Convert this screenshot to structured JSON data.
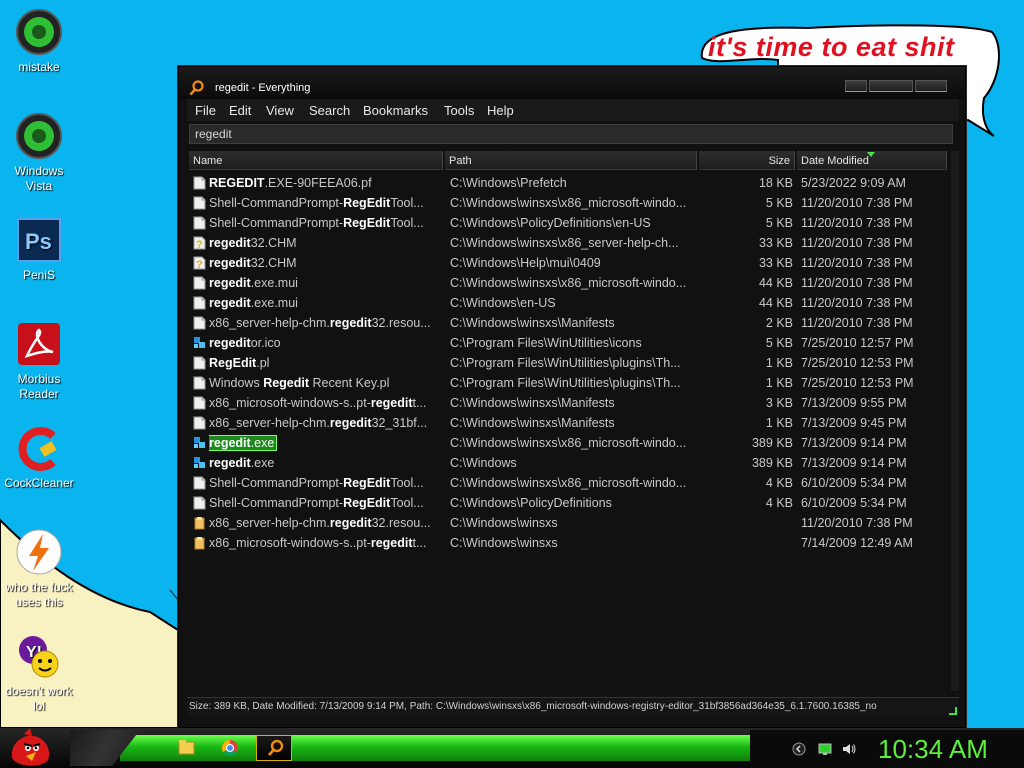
{
  "speech_bubble": {
    "text": "it's time to eat shit"
  },
  "desktop_icons": [
    {
      "label": "mistake"
    },
    {
      "label": "Windows Vista"
    },
    {
      "label": "PeniS"
    },
    {
      "label": "Morbius Reader"
    },
    {
      "label": "CockCleaner"
    },
    {
      "label": "who the fuck uses this"
    },
    {
      "label": "doesn't work lol"
    }
  ],
  "window": {
    "title": "regedit - Everything",
    "menu": [
      "File",
      "Edit",
      "View",
      "Search",
      "Bookmarks",
      "Tools",
      "Help"
    ],
    "search_value": "regedit",
    "columns": {
      "name": "Name",
      "path": "Path",
      "size": "Size",
      "date": "Date Modified"
    },
    "rows": [
      {
        "pre": "",
        "hl": "REGEDIT",
        "post": ".EXE-90FEEA06.pf",
        "path": "C:\\Windows\\Prefetch",
        "size": "18 KB",
        "date": "5/23/2022 9:09 AM",
        "icon": "doc-icon"
      },
      {
        "pre": "Shell-CommandPrompt-",
        "hl": "RegEdit",
        "post": "Tool...",
        "path": "C:\\Windows\\winsxs\\x86_microsoft-windo...",
        "size": "5 KB",
        "date": "11/20/2010 7:38 PM",
        "icon": "doc-icon"
      },
      {
        "pre": "Shell-CommandPrompt-",
        "hl": "RegEdit",
        "post": "Tool...",
        "path": "C:\\Windows\\PolicyDefinitions\\en-US",
        "size": "5 KB",
        "date": "11/20/2010 7:38 PM",
        "icon": "doc-icon"
      },
      {
        "pre": "",
        "hl": "regedit",
        "post": "32.CHM",
        "path": "C:\\Windows\\winsxs\\x86_server-help-ch...",
        "size": "33 KB",
        "date": "11/20/2010 7:38 PM",
        "icon": "help-file-icon"
      },
      {
        "pre": "",
        "hl": "regedit",
        "post": "32.CHM",
        "path": "C:\\Windows\\Help\\mui\\0409",
        "size": "33 KB",
        "date": "11/20/2010 7:38 PM",
        "icon": "help-file-icon"
      },
      {
        "pre": "",
        "hl": "regedit",
        "post": ".exe.mui",
        "path": "C:\\Windows\\winsxs\\x86_microsoft-windo...",
        "size": "44 KB",
        "date": "11/20/2010 7:38 PM",
        "icon": "doc-icon"
      },
      {
        "pre": "",
        "hl": "regedit",
        "post": ".exe.mui",
        "path": "C:\\Windows\\en-US",
        "size": "44 KB",
        "date": "11/20/2010 7:38 PM",
        "icon": "doc-icon"
      },
      {
        "pre": "x86_server-help-chm.",
        "hl": "regedit",
        "post": "32.resou...",
        "path": "C:\\Windows\\winsxs\\Manifests",
        "size": "2 KB",
        "date": "11/20/2010 7:38 PM",
        "icon": "doc-icon"
      },
      {
        "pre": "",
        "hl": "regedit",
        "post": "or.ico",
        "path": "C:\\Program Files\\WinUtilities\\icons",
        "size": "5 KB",
        "date": "7/25/2010 12:57 PM",
        "icon": "registry-icon"
      },
      {
        "pre": "",
        "hl": "RegEdit",
        "post": ".pl",
        "path": "C:\\Program Files\\WinUtilities\\plugins\\Th...",
        "size": "1 KB",
        "date": "7/25/2010 12:53 PM",
        "icon": "doc-icon"
      },
      {
        "pre": "Windows ",
        "hl": "Regedit",
        "post": " Recent Key.pl",
        "path": "C:\\Program Files\\WinUtilities\\plugins\\Th...",
        "size": "1 KB",
        "date": "7/25/2010 12:53 PM",
        "icon": "doc-icon"
      },
      {
        "pre": "x86_microsoft-windows-s..pt-",
        "hl": "regedit",
        "post": "t...",
        "path": "C:\\Windows\\winsxs\\Manifests",
        "size": "3 KB",
        "date": "7/13/2009 9:55 PM",
        "icon": "doc-icon"
      },
      {
        "pre": "x86_server-help-chm.",
        "hl": "regedit",
        "post": "32_31bf...",
        "path": "C:\\Windows\\winsxs\\Manifests",
        "size": "1 KB",
        "date": "7/13/2009 9:45 PM",
        "icon": "doc-icon"
      },
      {
        "pre": "",
        "hl": "regedit",
        "post": ".exe",
        "path": "C:\\Windows\\winsxs\\x86_microsoft-windo...",
        "size": "389 KB",
        "date": "7/13/2009 9:14 PM",
        "icon": "registry-icon",
        "selected": true
      },
      {
        "pre": "",
        "hl": "regedit",
        "post": ".exe",
        "path": "C:\\Windows",
        "size": "389 KB",
        "date": "7/13/2009 9:14 PM",
        "icon": "registry-icon"
      },
      {
        "pre": "Shell-CommandPrompt-",
        "hl": "RegEdit",
        "post": "Tool...",
        "path": "C:\\Windows\\winsxs\\x86_microsoft-windo...",
        "size": "4 KB",
        "date": "6/10/2009 5:34 PM",
        "icon": "doc-icon"
      },
      {
        "pre": "Shell-CommandPrompt-",
        "hl": "RegEdit",
        "post": "Tool...",
        "path": "C:\\Windows\\PolicyDefinitions",
        "size": "4 KB",
        "date": "6/10/2009 5:34 PM",
        "icon": "doc-icon"
      },
      {
        "pre": "x86_server-help-chm.",
        "hl": "regedit",
        "post": "32.resou...",
        "path": "C:\\Windows\\winsxs",
        "size": "",
        "date": "11/20/2010 7:38 PM",
        "icon": "folder-icon"
      },
      {
        "pre": "x86_microsoft-windows-s..pt-",
        "hl": "regedit",
        "post": "t...",
        "path": "C:\\Windows\\winsxs",
        "size": "",
        "date": "7/14/2009 12:49 AM",
        "icon": "folder-icon"
      }
    ],
    "status": "Size: 389 KB, Date Modified: 7/13/2009 9:14 PM, Path: C:\\Windows\\winsxs\\x86_microsoft-windows-registry-editor_31bf3856ad364e35_6.1.7600.16385_no"
  },
  "taskbar": {
    "clock": "10:34 AM",
    "items": [
      "folder-icon",
      "chrome-icon",
      "search-icon"
    ],
    "tray": [
      "back-icon",
      "network-icon",
      "volume-icon"
    ]
  },
  "colors": {
    "desktop": "#0ab4ef",
    "accent": "#3ee63e",
    "highlight_row": "#1e8a1e",
    "bubble_text": "#e01020"
  }
}
